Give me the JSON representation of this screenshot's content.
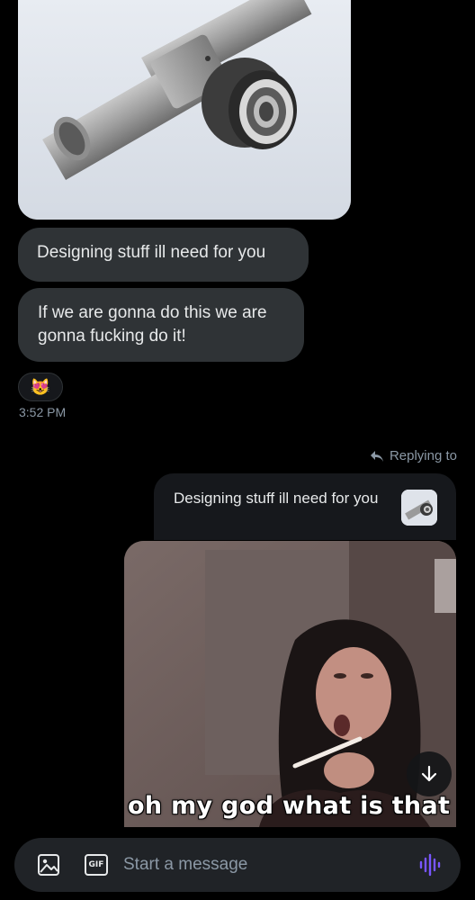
{
  "messages": {
    "received": [
      {
        "text": "Designing stuff ill need for you"
      },
      {
        "text": "If we are gonna do this we are gonna fucking do it!"
      }
    ],
    "reaction_emoji": "😻",
    "timestamp": "3:52 PM"
  },
  "reply": {
    "label": "Replying to",
    "quoted_text": "Designing stuff ill need for you"
  },
  "gif": {
    "caption": "oh my god what is that"
  },
  "composer": {
    "placeholder": "Start a message",
    "gif_label": "GIF"
  },
  "colors": {
    "background": "#000000",
    "bubble": "#2f3336",
    "muted_text": "#8b98a5",
    "voice_accent": "#7856ff"
  },
  "icons": [
    "image-icon",
    "gif-icon",
    "voice-icon",
    "arrow-down-icon",
    "reply-arrow-icon"
  ]
}
